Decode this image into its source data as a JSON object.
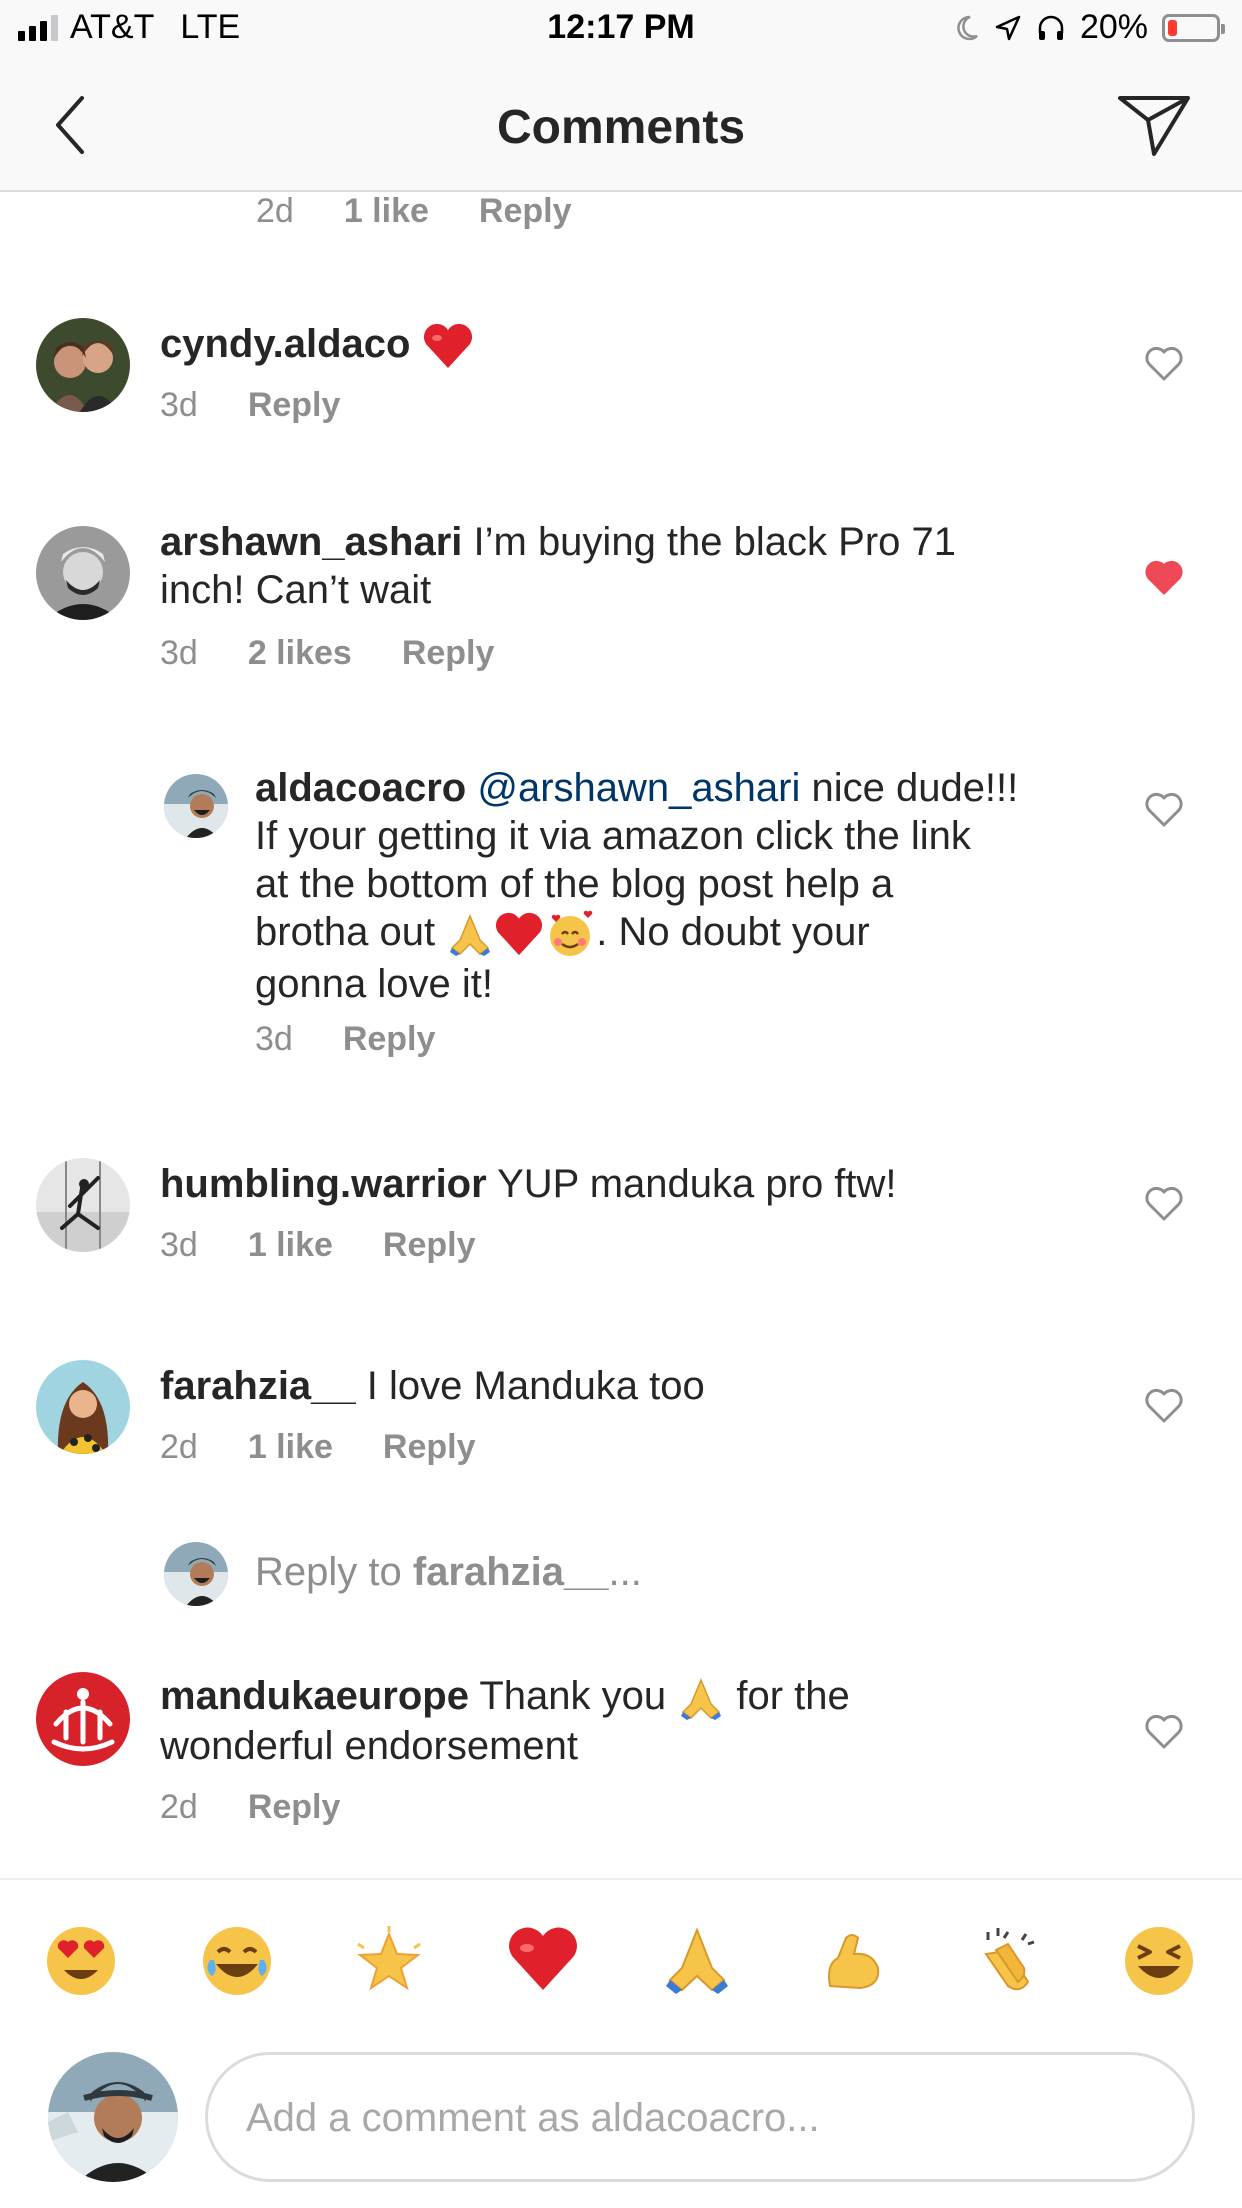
{
  "status_bar": {
    "carrier": "AT&T",
    "network": "LTE",
    "time": "12:17 PM",
    "battery": "20%",
    "battery_level": 0.2,
    "icons": [
      "signal-icon",
      "moon-icon",
      "location-icon",
      "headphones-icon",
      "battery-icon"
    ]
  },
  "header": {
    "title": "Comments",
    "back_icon": "chevron-left-icon",
    "share_icon": "paper-plane-icon"
  },
  "comments": [
    {
      "id": "partial",
      "time": "2d",
      "likes": "1 like",
      "reply": "Reply"
    },
    {
      "id": "cyndy",
      "username": "cyndy.aldaco",
      "text": "",
      "emoji": "heart",
      "time": "3d",
      "likes": "",
      "reply": "Reply",
      "liked": false
    },
    {
      "id": "arshawn",
      "username": "arshawn_ashari",
      "text_line1": " I’m buying the black Pro 71",
      "text_line2": "inch! Can’t wait",
      "time": "3d",
      "likes": "2 likes",
      "reply": "Reply",
      "liked": true
    },
    {
      "id": "aldaco",
      "username": "aldacoacro",
      "mention": "@arshawn_ashari",
      "text_line1": " nice dude!!!",
      "text_line2": "If your getting it via amazon click the link",
      "text_line3": "at the bottom of the blog post help a",
      "text_line4a": "brotha out ",
      "text_line4b": ". No doubt your",
      "text_line5": "gonna love it!",
      "time": "3d",
      "reply": "Reply",
      "liked": false
    },
    {
      "id": "humbling",
      "username": "humbling.warrior",
      "text": " YUP manduka pro ftw!",
      "time": "3d",
      "likes": "1 like",
      "reply": "Reply",
      "liked": false
    },
    {
      "id": "farahzia",
      "username": "farahzia__",
      "text": " I love Manduka too",
      "time": "2d",
      "likes": "1 like",
      "reply": "Reply",
      "liked": false
    },
    {
      "id": "manduka",
      "username": "mandukaeurope",
      "text_line1a": " Thank you ",
      "text_line1b": " for the",
      "text_line2": "wonderful endorsement",
      "time": "2d",
      "reply": "Reply",
      "liked": false
    }
  ],
  "reply_prompt": {
    "prefix": "Reply to ",
    "target": "farahzia__",
    "suffix": "..."
  },
  "emoji_bar": [
    "heart-eyes",
    "joy",
    "glowing-star",
    "red-heart",
    "folded-hands",
    "flexed-biceps",
    "clapping-hands",
    "laughing"
  ],
  "composer": {
    "placeholder": "Add a comment as aldacoacro..."
  },
  "colors": {
    "like_red": "#ed4956",
    "text": "#262626",
    "meta": "#8e8e8e",
    "mention": "#003569",
    "divider": "#dbdbdb"
  }
}
